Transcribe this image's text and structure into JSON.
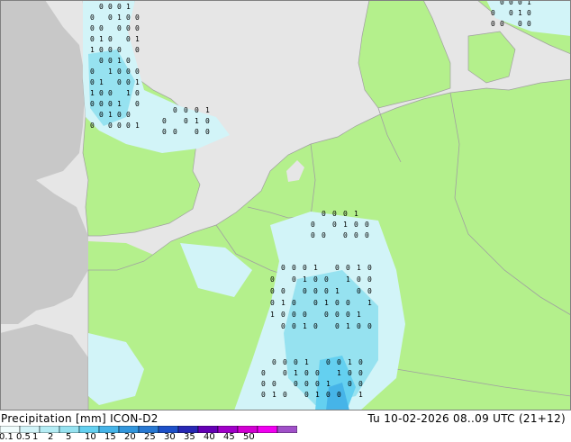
{
  "header": {
    "title_left": "Precipitation [mm]  ICON-D2",
    "title_right": "Tu 10-02-2026 08..09 UTC (21+12)"
  },
  "legend": {
    "ticks": [
      "0.1",
      "0.5",
      "1",
      "2",
      "5",
      "10",
      "15",
      "20",
      "25",
      "30",
      "35",
      "40",
      "45",
      "50"
    ],
    "colors": [
      "#f0fcfc",
      "#d2f4f8",
      "#b4ecf4",
      "#96e2f0",
      "#64d0f0",
      "#46b4e8",
      "#3296dc",
      "#2878d2",
      "#1e50c8",
      "#2828b4",
      "#6400b4",
      "#a000c8",
      "#d200d2",
      "#f000f0",
      "#a050c8"
    ]
  },
  "map_colors": {
    "sea": "#e6e6e6",
    "land_model": "#b4f08c",
    "land_outside": "#c8c8c8",
    "border": "#a0a0a0"
  }
}
